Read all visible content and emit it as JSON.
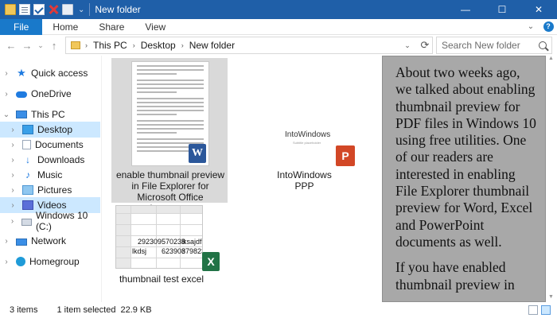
{
  "window": {
    "title": "New folder",
    "controls": {
      "minimize": "—",
      "maximize": "☐",
      "close": "✕"
    },
    "quick_access_toolbar": [
      "folder-icon",
      "properties-icon",
      "check-icon",
      "delete-icon",
      "rename-icon"
    ],
    "qat_dropdown": "⌄"
  },
  "ribbon": {
    "tabs": [
      "File",
      "Home",
      "Share",
      "View"
    ],
    "collapse_caret": "⌄",
    "help": "?"
  },
  "navigation": {
    "back": "←",
    "forward": "→",
    "recent": "⌄",
    "up": "↑",
    "breadcrumb": [
      "This PC",
      "Desktop",
      "New folder"
    ],
    "crumb_separator": "›",
    "address_dropdown": "⌄",
    "refresh": "⟳",
    "search_placeholder": "Search New folder"
  },
  "nav_pane": {
    "items": [
      {
        "label": "Quick access",
        "icon": "star-icon",
        "chevron": "›"
      },
      {
        "label": "OneDrive",
        "icon": "cloud-icon",
        "chevron": "›"
      },
      {
        "label": "This PC",
        "icon": "computer-icon",
        "chevron": "⌄"
      },
      {
        "label": "Desktop",
        "icon": "desktop-icon",
        "chevron": "›",
        "selected": true
      },
      {
        "label": "Documents",
        "icon": "documents-icon",
        "chevron": "›"
      },
      {
        "label": "Downloads",
        "icon": "downloads-icon",
        "chevron": "›"
      },
      {
        "label": "Music",
        "icon": "music-icon",
        "chevron": "›"
      },
      {
        "label": "Pictures",
        "icon": "pictures-icon",
        "chevron": "›"
      },
      {
        "label": "Videos",
        "icon": "videos-icon",
        "chevron": "›",
        "selected": true
      },
      {
        "label": "Windows 10 (C:)",
        "icon": "drive-icon",
        "chevron": "›"
      },
      {
        "label": "Network",
        "icon": "network-icon",
        "chevron": "›"
      },
      {
        "label": "Homegroup",
        "icon": "homegroup-icon",
        "chevron": "›"
      }
    ]
  },
  "files": [
    {
      "name": "enable thumbnail preview in File Explorer for Microsoft Office documents",
      "type": "word",
      "badge": "W",
      "selected": true
    },
    {
      "name": "IntoWindows PPP",
      "type": "powerpoint",
      "badge": "P",
      "thumb_title": "IntoWindows",
      "thumb_subtitle": "Subtitle placeholder"
    },
    {
      "name": "thumbnail test excel",
      "type": "excel",
      "badge": "X",
      "cells": {
        "r1c1": "292309",
        "r1c2": "570238",
        "r1c3": "lksajdf",
        "r2c1": "lkdsj",
        "r2c2": "623903",
        "r2c3": "87982398"
      }
    }
  ],
  "preview": {
    "paragraphs": [
      "About two weeks ago, we talked about enabling thumbnail preview for PDF files in Windows 10 using free utilities. One of our readers are interested in enabling File Explorer thumbnail preview for Word, Excel and PowerPoint documents as well.",
      "If you have enabled thumbnail preview in"
    ]
  },
  "status": {
    "items_count": "3 items",
    "selected": "1 item selected",
    "size": "22.9 KB"
  },
  "colors": {
    "titlebar": "#1f5fa8",
    "file_tab": "#1979ca",
    "selection": "#cce8ff",
    "preview_bg": "#a8a8a8",
    "word": "#2b579a",
    "powerpoint": "#d24726",
    "excel": "#217346"
  }
}
